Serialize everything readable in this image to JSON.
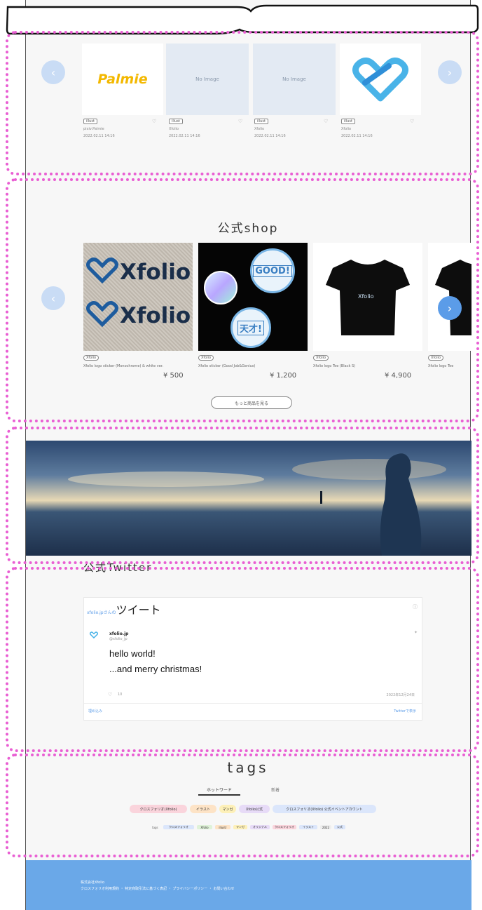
{
  "gallery": {
    "items": [
      {
        "image_text": "Palmie",
        "tag": "illust",
        "author": "pixiv.Palmie",
        "date": "2022.02.11 14:16"
      },
      {
        "image_text": "No Image",
        "tag": "illust",
        "author": "Xfolio",
        "date": "2022.02.11 14:16"
      },
      {
        "image_text": "No Image",
        "tag": "illust",
        "author": "Xfolio",
        "date": "2022.02.11 14:16"
      },
      {
        "image_text": "",
        "tag": "illust",
        "author": "Xfolio",
        "date": "2022.02.11 14:16"
      }
    ]
  },
  "shop": {
    "title": "公式shop",
    "items": [
      {
        "badge": "Xfolio",
        "title": "Xfolio logo sticker (Monochrome) & white ver.",
        "price": "¥ 500",
        "logo_text": "Xfolio"
      },
      {
        "badge": "Xfolio",
        "title": "Xfolio sticker (Good Job&Genius)",
        "price": "¥ 1,200",
        "stamp_good": "GOOD!",
        "stamp_genius": "天才!"
      },
      {
        "badge": "Xfolio",
        "title": "Xfolio logo Tee (Black S)",
        "price": "¥ 4,900",
        "shirt_text": "Xfolio"
      },
      {
        "badge": "Xfolio",
        "title": "Xfolio logo Tee",
        "price": ""
      }
    ],
    "more_label": "もっと商品を見る"
  },
  "twitter": {
    "title": "公式Twitter",
    "header_prefix": "xfolio.jpさんの",
    "header": "ツイート",
    "account_name": "xfolio.jp",
    "account_handle": "@xfolio_jp",
    "tweet_line1": "hello world!",
    "tweet_line2": "...and merry christmas!",
    "like_count": "10",
    "date": "2022年12月24日",
    "embed": "埋め込み",
    "view_on": "Twitterで表示"
  },
  "tags": {
    "title": "tags",
    "tab_active": "ホットワード",
    "tab_other": "新着",
    "pills": [
      {
        "label": "クロスフォリオ(Xfolio)",
        "color": "#fad4dc"
      },
      {
        "label": "イラスト",
        "color": "#fde3c6"
      },
      {
        "label": "マンガ",
        "color": "#fdf0b8"
      },
      {
        "label": "Xfolio公式",
        "color": "#e7dbf7"
      },
      {
        "label": "クロスフォリオ(Xfolio) 公式イベントアカウント",
        "color": "#dbe6fb"
      }
    ],
    "mini_label": "tags",
    "mini": [
      {
        "label": "クロスフォリオ",
        "color": "#dbe6fb"
      },
      {
        "label": "Xfolio",
        "color": "#dff2d8"
      },
      {
        "label": "illustr",
        "color": "#fde3c6"
      },
      {
        "label": "マンガ",
        "color": "#fdf0b8"
      },
      {
        "label": "オリジナル",
        "color": "#e7dbf7"
      },
      {
        "label": "クロスフォリオ",
        "color": "#fad4dc"
      },
      {
        "label": "イラスト",
        "color": "#dbe6fb"
      },
      {
        "label": "2022",
        "color": "#eeeeee"
      },
      {
        "label": "公式",
        "color": "#dbe6fb"
      }
    ]
  },
  "footer": {
    "line1": "株式会社Xfolio",
    "line2": "クロスフォリオ利用規約 ・ 特定商取引法に基づく表記 ・ プライバシーポリシー ・ お問い合わせ"
  },
  "colors": {
    "accent": "#5b9ce8",
    "footer": "#6aa8e8",
    "annotation": "#e95ed3"
  }
}
